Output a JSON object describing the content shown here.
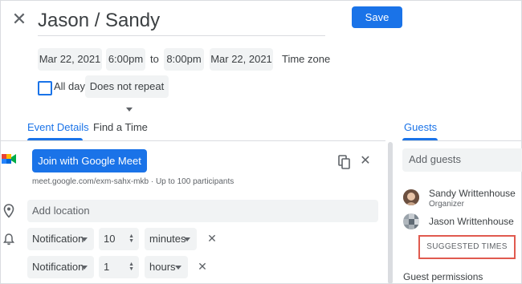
{
  "header": {
    "title": "Jason / Sandy",
    "save_label": "Save"
  },
  "datetime": {
    "start_date": "Mar 22, 2021",
    "start_time": "6:00pm",
    "to_label": "to",
    "end_time": "8:00pm",
    "end_date": "Mar 22, 2021",
    "timezone_label": "Time zone"
  },
  "options": {
    "all_day_label": "All day",
    "all_day_checked": false,
    "repeat_value": "Does not repeat"
  },
  "tabs": [
    {
      "label": "Event Details",
      "active": true
    },
    {
      "label": "Find a Time",
      "active": false
    }
  ],
  "meet": {
    "button_label": "Join with Google Meet",
    "link_text": "meet.google.com/exm-sahx-mkb · Up to 100 participants"
  },
  "location": {
    "placeholder": "Add location"
  },
  "notifications": [
    {
      "type": "Notification",
      "amount": "10",
      "unit": "minutes"
    },
    {
      "type": "Notification",
      "amount": "1",
      "unit": "hours"
    }
  ],
  "guests": {
    "tab_label": "Guests",
    "add_placeholder": "Add guests",
    "list": [
      {
        "name": "Sandy Writtenhouse",
        "role": "Organizer"
      },
      {
        "name": "Jason Writtenhouse",
        "role": ""
      }
    ],
    "suggested_times_label": "SUGGESTED TIMES",
    "permissions_label": "Guest permissions"
  },
  "colors": {
    "accent": "#1a73e8",
    "highlight_box": "#e05a4f",
    "field_bg": "#f1f3f4"
  }
}
